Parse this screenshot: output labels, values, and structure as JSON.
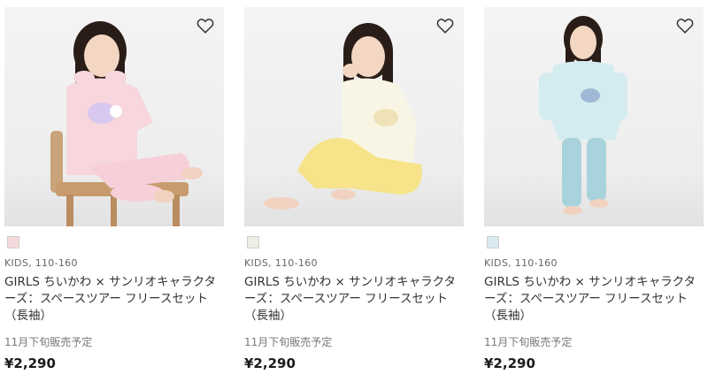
{
  "products": [
    {
      "swatch_color": "#f6d9dc",
      "meta": "KIDS, 110-160",
      "title_line1": "GIRLS ちいかわ × サンリオキャラクタ",
      "title_line2": "ーズ：スペースツアー フリースセット",
      "title_line3": "（長袖）",
      "sale_date": "11月下旬販売予定",
      "price": "¥2,290",
      "outfit_top": "#f8d6dd",
      "outfit_bottom": "#f6cfd8",
      "has_chair": true
    },
    {
      "swatch_color": "#ecefe4",
      "meta": "KIDS, 110-160",
      "title_line1": "GIRLS ちいかわ × サンリオキャラクタ",
      "title_line2": "ーズ：スペースツアー フリースセット",
      "title_line3": "（長袖）",
      "sale_date": "11月下旬販売予定",
      "price": "¥2,290",
      "outfit_top": "#f8f5e4",
      "outfit_bottom": "#f6e38a",
      "has_chair": false
    },
    {
      "swatch_color": "#d9eaf0",
      "meta": "KIDS, 110-160",
      "title_line1": "GIRLS ちいかわ × サンリオキャラクタ",
      "title_line2": "ーズ：スペースツアー フリースセット",
      "title_line3": "（長袖）",
      "sale_date": "11月下旬販売予定",
      "price": "¥2,290",
      "outfit_top": "#d4ecf0",
      "outfit_bottom": "#a9d3dc",
      "has_chair": false
    }
  ],
  "icons": {
    "favorite": "heart-outline-icon"
  }
}
